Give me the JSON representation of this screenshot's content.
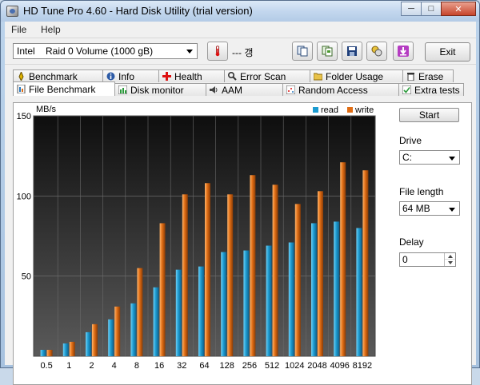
{
  "window": {
    "title": "HD Tune Pro 4.60 - Hard Disk Utility (trial version)",
    "minimize_glyph": "─",
    "maximize_glyph": "□",
    "close_glyph": "✕"
  },
  "menu": {
    "file_label": "File",
    "help_label": "Help"
  },
  "toolbar": {
    "drive_value": "Intel    Raid 0 Volume (1000 gB)",
    "temperature_text": "--- 갱",
    "exit_label": "Exit",
    "buttons": [
      {
        "name": "copy-info-button",
        "icon": "copy-icon"
      },
      {
        "name": "copy-screen-button",
        "icon": "copy-screen-icon"
      },
      {
        "name": "save-button",
        "icon": "save-icon"
      },
      {
        "name": "options-button",
        "icon": "options-icon"
      },
      {
        "name": "download-button",
        "icon": "download-icon"
      }
    ]
  },
  "tabs_top": [
    {
      "label": "Benchmark",
      "icon": "benchmark-icon"
    },
    {
      "label": "Info",
      "icon": "info-icon"
    },
    {
      "label": "Health",
      "icon": "health-icon"
    },
    {
      "label": "Error Scan",
      "icon": "error-scan-icon"
    },
    {
      "label": "Folder Usage",
      "icon": "folder-icon"
    },
    {
      "label": "Erase",
      "icon": "erase-icon"
    }
  ],
  "tabs_bottom": [
    {
      "label": "File Benchmark",
      "icon": "file-benchmark-icon",
      "active": true
    },
    {
      "label": "Disk monitor",
      "icon": "disk-monitor-icon",
      "active": false
    },
    {
      "label": "AAM",
      "icon": "aam-icon",
      "active": false
    },
    {
      "label": "Random Access",
      "icon": "random-access-icon",
      "active": false
    },
    {
      "label": "Extra tests",
      "icon": "extra-tests-icon",
      "active": false
    }
  ],
  "side": {
    "start_label": "Start",
    "drive_label": "Drive",
    "drive_value": "C:",
    "file_length_label": "File length",
    "file_length_value": "64 MB",
    "delay_label": "Delay",
    "delay_value": "0"
  },
  "colors": {
    "read": "#1c9bd0",
    "write": "#e06d14",
    "plot_bg_top": "#0e0e0e",
    "plot_bg_bottom": "#5a5a5a"
  },
  "chart_data": {
    "type": "bar",
    "ylabel": "MB/s",
    "ylim": [
      0,
      150
    ],
    "yticks": [
      50,
      100,
      150
    ],
    "grid": true,
    "legend_position": "top-right",
    "categories": [
      "0.5",
      "1",
      "2",
      "4",
      "8",
      "16",
      "32",
      "64",
      "128",
      "256",
      "512",
      "1024",
      "2048",
      "4096",
      "8192"
    ],
    "series": [
      {
        "name": "read",
        "values": [
          4,
          8,
          15,
          23,
          33,
          43,
          54,
          56,
          65,
          66,
          69,
          71,
          83,
          84,
          80
        ]
      },
      {
        "name": "write",
        "values": [
          4,
          9,
          20,
          31,
          55,
          83,
          101,
          108,
          101,
          113,
          107,
          95,
          103,
          121,
          116
        ]
      }
    ]
  }
}
